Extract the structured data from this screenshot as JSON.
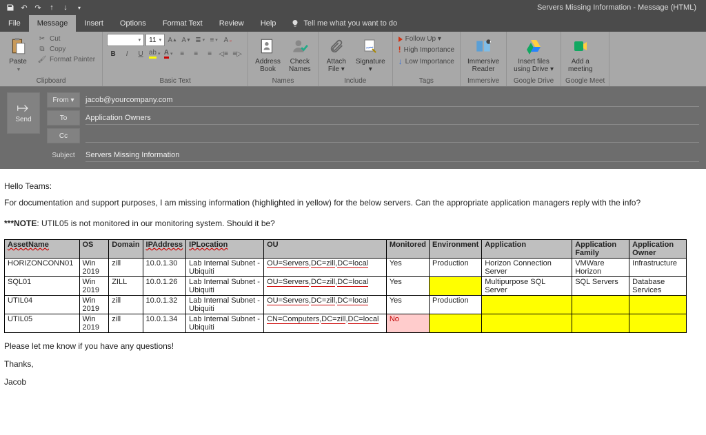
{
  "window_title": "Servers Missing Information  -  Message (HTML)",
  "qat": {
    "save": "save",
    "undo": "↶",
    "redo": "↷",
    "up": "↑",
    "down": "↓",
    "more": "▾"
  },
  "menu": {
    "file": "File",
    "message": "Message",
    "insert": "Insert",
    "options": "Options",
    "format_text": "Format Text",
    "review": "Review",
    "help": "Help",
    "tell_me": "Tell me what you want to do"
  },
  "ribbon": {
    "clipboard": {
      "label": "Clipboard",
      "paste": "Paste",
      "cut": "Cut",
      "copy": "Copy",
      "format_painter": "Format Painter"
    },
    "basic_text": {
      "label": "Basic Text",
      "font_size": "11"
    },
    "names": {
      "label": "Names",
      "address_book": "Address\nBook",
      "check_names": "Check\nNames"
    },
    "include": {
      "label": "Include",
      "attach_file": "Attach\nFile ▾",
      "signature": "Signature\n▾"
    },
    "tags": {
      "label": "Tags",
      "follow_up": "Follow Up ▾",
      "high": "High Importance",
      "low": "Low Importance"
    },
    "immersive": {
      "label": "Immersive",
      "reader": "Immersive\nReader"
    },
    "drive": {
      "label": "Google Drive",
      "insert": "Insert files\nusing Drive ▾"
    },
    "meet": {
      "label": "Google Meet",
      "add": "Add a\nmeeting"
    }
  },
  "compose": {
    "send": "Send",
    "from_btn": "From  ▾",
    "from_val": "jacob@yourcompany.com",
    "to_btn": "To",
    "to_val": "Application Owners",
    "cc_btn": "Cc",
    "subject_lbl": "Subject",
    "subject_val": "Servers Missing Information"
  },
  "body": {
    "greeting": "Hello Teams:",
    "p1": "For documentation and support purposes, I am missing information (highlighted in yellow) for the below servers.  Can the appropriate application managers reply with the info?",
    "note_prefix": "***NOTE",
    "note_rest": ":  UTIL05 is not monitored in our monitoring system.  Should it be?",
    "closing1": "Please let me know if you have any questions!",
    "closing2": "Thanks,",
    "sig": "Jacob"
  },
  "table": {
    "headers": {
      "asset": "AssetName",
      "os": "OS",
      "domain": "Domain",
      "ip": "IPAddress",
      "iploc": "IPLocation",
      "ou": "OU",
      "monitored": "Monitored",
      "env": "Environment",
      "app": "Application",
      "appfam": "Application Family",
      "owner": "Application Owner"
    },
    "rows": [
      {
        "asset": "HORIZONCONN01",
        "os": "Win 2019",
        "domain": "zill",
        "ip": "10.0.1.30",
        "iploc": "Lab Internal Subnet - Ubiquiti",
        "ou": "OU=Servers,DC=zill,DC=local",
        "monitored": "Yes",
        "env": "Production",
        "app": "Horizon Connection Server",
        "appfam": "VMWare Horizon",
        "owner": "Infrastructure",
        "hl": {}
      },
      {
        "asset": "SQL01",
        "os": "Win 2019",
        "domain": "ZILL",
        "ip": "10.0.1.26",
        "iploc": "Lab Internal Subnet - Ubiquiti",
        "ou": "OU=Servers,DC=zill,DC=local",
        "monitored": "Yes",
        "env": "",
        "app": "Multipurpose SQL Server",
        "appfam": "SQL Servers",
        "owner": "Database Services",
        "hl": {
          "env": "y"
        }
      },
      {
        "asset": "UTIL04",
        "os": "Win 2019",
        "domain": "zill",
        "ip": "10.0.1.32",
        "iploc": "Lab Internal Subnet - Ubiquiti",
        "ou": "OU=Servers,DC=zill,DC=local",
        "monitored": "Yes",
        "env": "Production",
        "app": "",
        "appfam": "",
        "owner": "",
        "hl": {
          "app": "y",
          "appfam": "y",
          "owner": "y"
        }
      },
      {
        "asset": "UTIL05",
        "os": "Win 2019",
        "domain": "zill",
        "ip": "10.0.1.34",
        "iploc": "Lab Internal Subnet - Ubiquiti",
        "ou": "CN=Computers,DC=zill,DC=local",
        "monitored": "No",
        "env": "",
        "app": "",
        "appfam": "",
        "owner": "",
        "hl": {
          "monitored": "p",
          "env": "y",
          "app": "y",
          "appfam": "y",
          "owner": "y"
        }
      }
    ]
  }
}
